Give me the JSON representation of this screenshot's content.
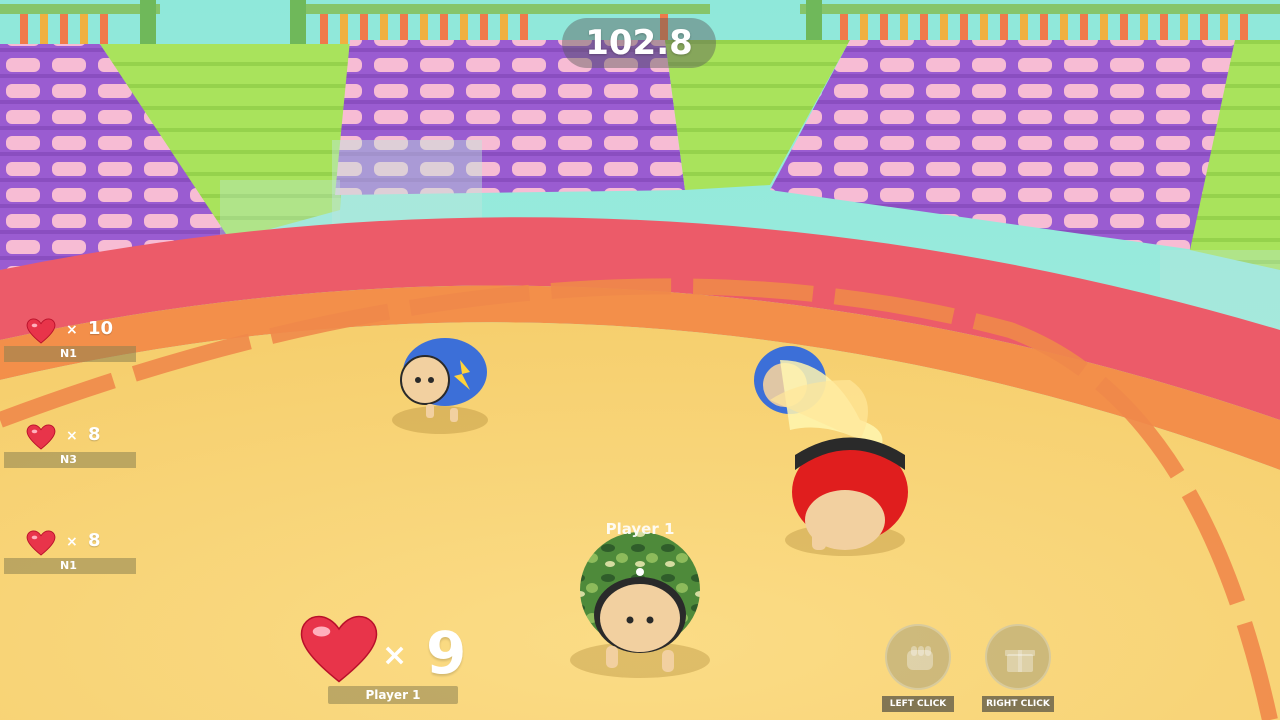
{
  "hud": {
    "timer": "102.8"
  },
  "scoreboard": [
    {
      "times": "×",
      "lives": "10",
      "name": "N1"
    },
    {
      "times": "×",
      "lives": "8",
      "name": "N3"
    },
    {
      "times": "×",
      "lives": "8",
      "name": "N1"
    }
  ],
  "player": {
    "tag": "Player 1",
    "times": "×",
    "lives": "9",
    "name": "Player 1"
  },
  "controls": {
    "left_label": "LEFT CLICK",
    "right_label": "RIGHT CLICK"
  },
  "colors": {
    "sand": "#f8d77a",
    "ring_orange": "#f1904b",
    "ring_red": "#e85a5f",
    "stands_purple": "#9c5fd0",
    "grass_green": "#a8e05a",
    "heart_red": "#e8344a"
  },
  "icons": {
    "heart": "heart-icon",
    "left_action": "fist-icon",
    "right_action": "gift-icon"
  }
}
